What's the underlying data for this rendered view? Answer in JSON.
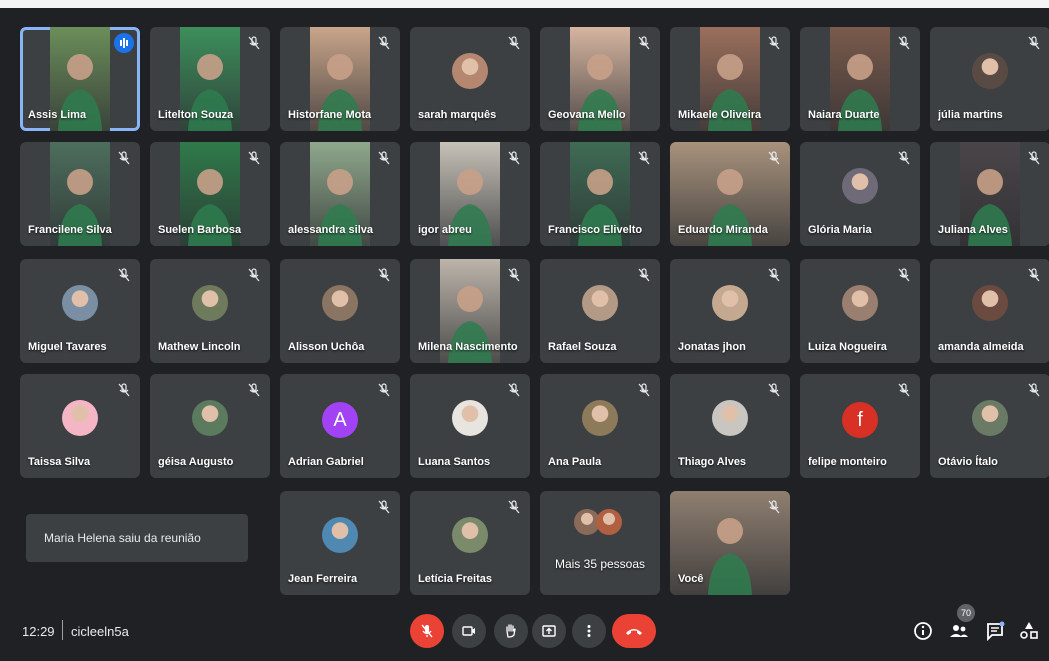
{
  "participants": [
    {
      "name": "Assis Lima",
      "view": "video",
      "bg": "#6b8e5a",
      "speaking": true
    },
    {
      "name": "Litelton Souza",
      "view": "video",
      "bg": "#3d8f5c"
    },
    {
      "name": "Historfane Mota",
      "view": "video",
      "bg": "#c9a58a"
    },
    {
      "name": "sarah marquês",
      "view": "avatar",
      "bg": "#b58770"
    },
    {
      "name": "Geovana Mello",
      "view": "video",
      "bg": "#d6b5a0"
    },
    {
      "name": "Mikaele Oliveira",
      "view": "video",
      "bg": "#9b6f5c"
    },
    {
      "name": "Naiara Duarte",
      "view": "video",
      "bg": "#7a5a4c"
    },
    {
      "name": "júlia martins",
      "view": "avatar",
      "bg": "#5a4a44"
    },
    {
      "name": "Francilene Silva",
      "view": "video",
      "bg": "#4d6e5c"
    },
    {
      "name": "Suelen Barbosa",
      "view": "video",
      "bg": "#2f7a4a"
    },
    {
      "name": "alessandra silva",
      "view": "video",
      "bg": "#8fa88c"
    },
    {
      "name": "igor abreu",
      "view": "video",
      "bg": "#c7c2b8"
    },
    {
      "name": "Francisco Elivelto",
      "view": "video",
      "bg": "#3f6b54"
    },
    {
      "name": "Eduardo Miranda",
      "view": "video-wide",
      "bg": "#a8927c"
    },
    {
      "name": "Glória Maria",
      "view": "avatar",
      "bg": "#6f6a78"
    },
    {
      "name": "Juliana Alves",
      "view": "video",
      "bg": "#4a4548"
    },
    {
      "name": "Miguel Tavares",
      "view": "avatar",
      "bg": "#7a8fa3"
    },
    {
      "name": "Mathew Lincoln",
      "view": "avatar",
      "bg": "#6e7a5c"
    },
    {
      "name": "Alisson Uchôa",
      "view": "avatar",
      "bg": "#8a7562"
    },
    {
      "name": "Milena Nascimento",
      "view": "video",
      "bg": "#bdb5aa"
    },
    {
      "name": "Rafael Souza",
      "view": "avatar",
      "bg": "#b39a86"
    },
    {
      "name": "Jonatas jhon",
      "view": "avatar",
      "bg": "#c4a88f"
    },
    {
      "name": "Luiza Nogueira",
      "view": "avatar",
      "bg": "#9a7f70"
    },
    {
      "name": "amanda almeida",
      "view": "avatar",
      "bg": "#6b4a3f"
    },
    {
      "name": "Taissa Silva",
      "view": "avatar",
      "bg": "#f4b6c4"
    },
    {
      "name": "géisa Augusto",
      "view": "avatar",
      "bg": "#5c7a5e"
    },
    {
      "name": "Adrian Gabriel",
      "view": "letter",
      "letter": "A",
      "bg": "#a142f4"
    },
    {
      "name": "Luana Santos",
      "view": "avatar",
      "bg": "#e8e4df"
    },
    {
      "name": "Ana Paula",
      "view": "avatar",
      "bg": "#8c7a5a"
    },
    {
      "name": "Thiago Alves",
      "view": "avatar",
      "bg": "#c9c6c2"
    },
    {
      "name": "felipe monteiro",
      "view": "letter",
      "letter": "f",
      "bg": "#d93025"
    },
    {
      "name": "Otávio Ítalo",
      "view": "avatar",
      "bg": "#6a7a64"
    },
    {
      "name": "Jean Ferreira",
      "view": "avatar",
      "bg": "#4f88b0"
    },
    {
      "name": "Letícia Freitas",
      "view": "avatar",
      "bg": "#7a8a6a"
    },
    {
      "name": "Mais 35 pessoas",
      "view": "more",
      "bg": "#8a6a58"
    },
    {
      "name": "Você",
      "view": "video-wide",
      "bg": "#8f7f70"
    }
  ],
  "notice": "Maria Helena saiu da reunião",
  "footer": {
    "time": "12:29",
    "meeting_code": "cicleeln5a",
    "participant_count": "70"
  },
  "colors": {
    "background": "#202124",
    "tile": "#3c4043",
    "danger": "#ea4335",
    "accent": "#8ab4f8"
  },
  "icons": {
    "mute": "mic-off-icon",
    "mic": "mic-off-icon",
    "camera": "camera-icon",
    "hand": "raise-hand-icon",
    "present": "present-icon",
    "more": "more-vert-icon",
    "leave": "hangup-icon",
    "info": "info-icon",
    "people": "people-icon",
    "chat": "chat-icon",
    "activities": "activities-icon"
  }
}
